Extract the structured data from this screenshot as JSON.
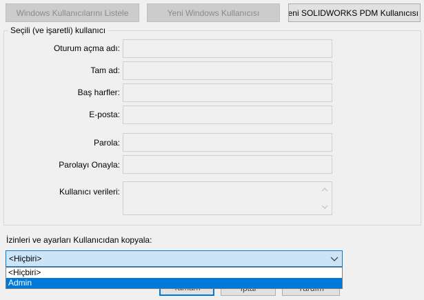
{
  "toolbar": {
    "list_windows_users": "Windows Kullanıcılarını Listele",
    "new_windows_user": "Yeni Windows Kullanıcısı",
    "new_pdm_user": "Yeni SOLIDWORKS PDM Kullanıcısı"
  },
  "group": {
    "title": "Seçili (ve işaretli) kullanıcı",
    "fields": {
      "login_name": {
        "label": "Oturum açma adı:",
        "value": ""
      },
      "full_name": {
        "label": "Tam ad:",
        "value": ""
      },
      "initials": {
        "label": "Baş harfler:",
        "value": ""
      },
      "email": {
        "label": "E-posta:",
        "value": ""
      },
      "password": {
        "label": "Parola:",
        "value": ""
      },
      "confirm_password": {
        "label": "Parolayı Onayla:",
        "value": ""
      },
      "user_data": {
        "label": "Kullanıcı verileri:",
        "value": ""
      }
    }
  },
  "copy": {
    "label": "İzinleri ve ayarları Kullanıcıdan kopyala:",
    "selected": "<Hiçbiri>",
    "options": [
      "<Hiçbiri>",
      "Admin"
    ],
    "highlighted_index": 1
  },
  "footer": {
    "ok": "Tamam",
    "cancel": "İptal",
    "help": "Yardım"
  },
  "colors": {
    "accent": "#0078d7",
    "combo_bg": "#cce4f7",
    "disabled_text": "#8a8a8a"
  }
}
